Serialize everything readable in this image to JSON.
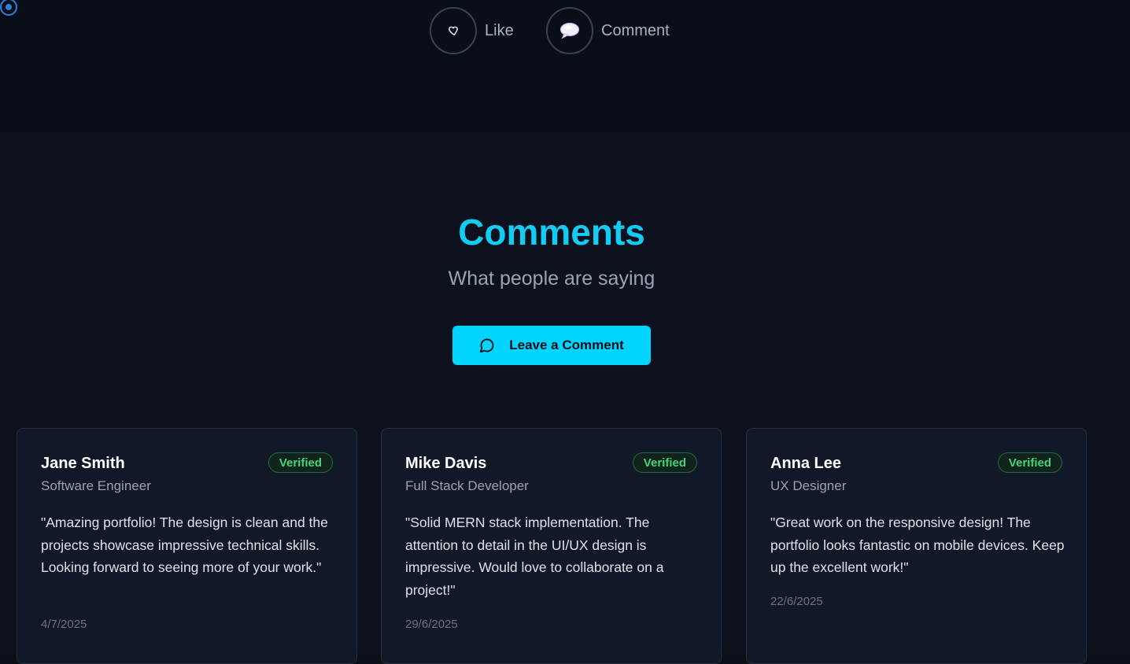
{
  "actions": {
    "like_label": "Like",
    "comment_label": "Comment"
  },
  "section": {
    "title": "Comments",
    "subtitle": "What people are saying",
    "cta_label": "Leave a Comment"
  },
  "comments": [
    {
      "name": "Jane Smith",
      "role": "Software Engineer",
      "badge": "Verified",
      "text": "\"Amazing portfolio! The design is clean and the projects showcase impressive technical skills. Looking forward to seeing more of your work.\"",
      "date": "4/7/2025"
    },
    {
      "name": "Mike Davis",
      "role": "Full Stack Developer",
      "badge": "Verified",
      "text": "\"Solid MERN stack implementation. The attention to detail in the UI/UX design is impressive. Would love to collaborate on a project!\"",
      "date": "29/6/2025"
    },
    {
      "name": "Anna Lee",
      "role": "UX Designer",
      "badge": "Verified",
      "text": "\"Great work on the responsive design! The portfolio looks fantastic on mobile devices. Keep up the excellent work!\"",
      "date": "22/6/2025"
    }
  ],
  "colors": {
    "accent": "#00d4ff",
    "title": "#11cdf4",
    "verified": "#3fd57b",
    "background": "#0c111d",
    "card": "#111827"
  },
  "icons": {
    "like": "heart-icon",
    "comment": "speech-balloon-icon",
    "cta": "message-circle-icon",
    "cursor": "cursor-indicator-icon"
  }
}
